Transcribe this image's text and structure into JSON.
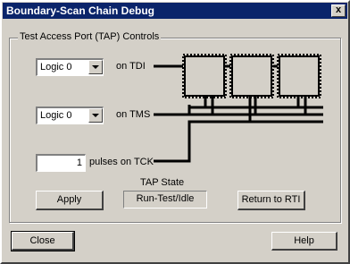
{
  "window": {
    "title": "Boundary-Scan Chain Debug",
    "close_glyph": "x"
  },
  "group": {
    "label": "Test Access Port (TAP) Controls"
  },
  "tdi": {
    "value": "Logic 0",
    "label": "on TDI"
  },
  "tms": {
    "value": "Logic 0",
    "label": "on TMS"
  },
  "tck": {
    "value": "1",
    "label": "pulses on TCK"
  },
  "tap_state": {
    "title": "TAP State",
    "value": "Run-Test/Idle"
  },
  "buttons": {
    "apply": "Apply",
    "return_rti": "Return to RTI",
    "close": "Close",
    "help": "Help"
  },
  "diagram": {
    "chip_count": 3
  }
}
